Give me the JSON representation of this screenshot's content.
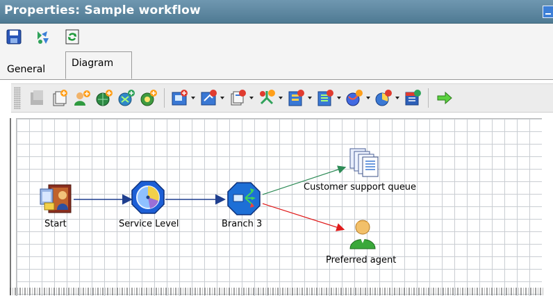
{
  "window": {
    "title": "Properties: Sample workflow"
  },
  "top_toolbar": {
    "icons": [
      "save-icon",
      "workflow-wizard-icon",
      "refresh-icon"
    ]
  },
  "tabs": [
    {
      "label": "General",
      "active": false
    },
    {
      "label": "Diagram",
      "active": true
    }
  ],
  "diagram_toolbar": {
    "icons": [
      "add-disabled-icon",
      "add-document-icon",
      "add-agent-icon",
      "add-globe-icon",
      "add-network-icon",
      "add-service-icon",
      "add-queue-node-icon",
      "add-interaction-node-icon",
      "add-document-node-icon",
      "add-branch-node-icon",
      "add-form-node-icon",
      "add-list-node-icon",
      "add-sphere-node-icon",
      "add-chart-node-icon",
      "add-calendar-node-icon",
      "arrow-right-icon"
    ]
  },
  "diagram": {
    "nodes": [
      {
        "id": "start",
        "label": "Start",
        "icon": "start-door-icon"
      },
      {
        "id": "service",
        "label": "Service Level",
        "icon": "service-level-gauge-icon"
      },
      {
        "id": "branch",
        "label": "Branch 3",
        "icon": "branch-icon"
      },
      {
        "id": "queue",
        "label": "Customer support queue",
        "icon": "queue-documents-icon"
      },
      {
        "id": "agent",
        "label": "Preferred agent",
        "icon": "agent-person-icon"
      }
    ],
    "connections": [
      {
        "from": "start",
        "to": "service",
        "color": "#1f3f8f"
      },
      {
        "from": "service",
        "to": "branch",
        "color": "#1f3f8f"
      },
      {
        "from": "branch",
        "to": "queue",
        "color": "#2e8b57"
      },
      {
        "from": "branch",
        "to": "agent",
        "color": "#e01b1b"
      }
    ]
  }
}
